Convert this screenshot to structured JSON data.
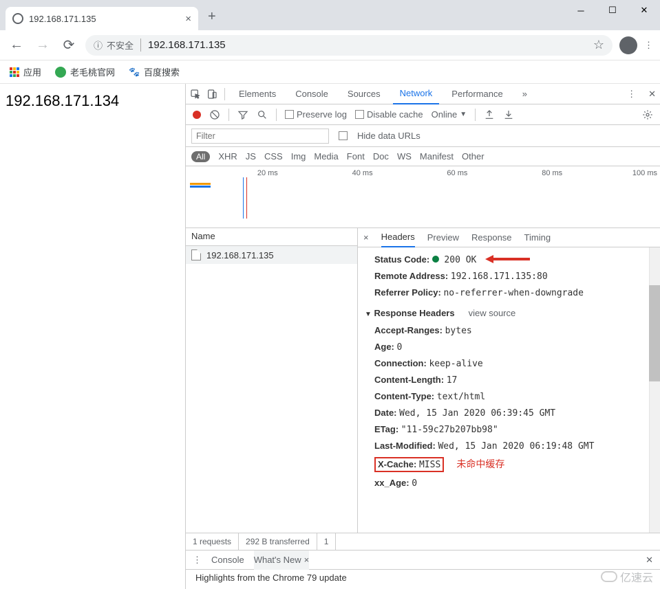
{
  "window": {
    "tab_title": "192.168.171.135"
  },
  "addressbar": {
    "insecure_label": "不安全",
    "url": "192.168.171.135"
  },
  "bookmarks": {
    "apps": "应用",
    "b1": "老毛桃官网",
    "b2": "百度搜索"
  },
  "page": {
    "h1": "192.168.171.134"
  },
  "devtools": {
    "tabs": {
      "elements": "Elements",
      "console": "Console",
      "sources": "Sources",
      "network": "Network",
      "performance": "Performance",
      "more": "»"
    },
    "toolbar": {
      "preserve": "Preserve log",
      "disable_cache": "Disable cache",
      "throttle": "Online"
    },
    "filter": {
      "placeholder": "Filter",
      "hide_urls": "Hide data URLs"
    },
    "types": [
      "All",
      "XHR",
      "JS",
      "CSS",
      "Img",
      "Media",
      "Font",
      "Doc",
      "WS",
      "Manifest",
      "Other"
    ],
    "timeline": [
      "20 ms",
      "40 ms",
      "60 ms",
      "80 ms",
      "100 ms"
    ],
    "list": {
      "header": "Name",
      "item0": "192.168.171.135"
    },
    "detail_tabs": {
      "headers": "Headers",
      "preview": "Preview",
      "response": "Response",
      "timing": "Timing"
    },
    "general": {
      "status_label": "Status Code:",
      "status_value": "200 OK",
      "remote_label": "Remote Address:",
      "remote_value": "192.168.171.135:80",
      "referrer_label": "Referrer Policy:",
      "referrer_value": "no-referrer-when-downgrade"
    },
    "resp_section": {
      "title": "Response Headers",
      "view_source": "view source"
    },
    "resp_headers": [
      {
        "k": "Accept-Ranges:",
        "v": "bytes"
      },
      {
        "k": "Age:",
        "v": "0"
      },
      {
        "k": "Connection:",
        "v": "keep-alive"
      },
      {
        "k": "Content-Length:",
        "v": "17"
      },
      {
        "k": "Content-Type:",
        "v": "text/html"
      },
      {
        "k": "Date:",
        "v": "Wed, 15 Jan 2020 06:39:45 GMT"
      },
      {
        "k": "ETag:",
        "v": "\"11-59c27b207bb98\""
      },
      {
        "k": "Last-Modified:",
        "v": "Wed, 15 Jan 2020 06:19:48 GMT"
      },
      {
        "k": "X-Cache:",
        "v": "MISS"
      },
      {
        "k": "xx_Age:",
        "v": "0"
      }
    ],
    "annotation": "未命中缓存",
    "status": {
      "requests": "1 requests",
      "transferred": "292 B transferred",
      "cut": "1"
    },
    "drawer": {
      "console": "Console",
      "whatsnew": "What's New"
    },
    "highlights": "Highlights from the Chrome 79 update"
  },
  "watermark": "亿速云"
}
